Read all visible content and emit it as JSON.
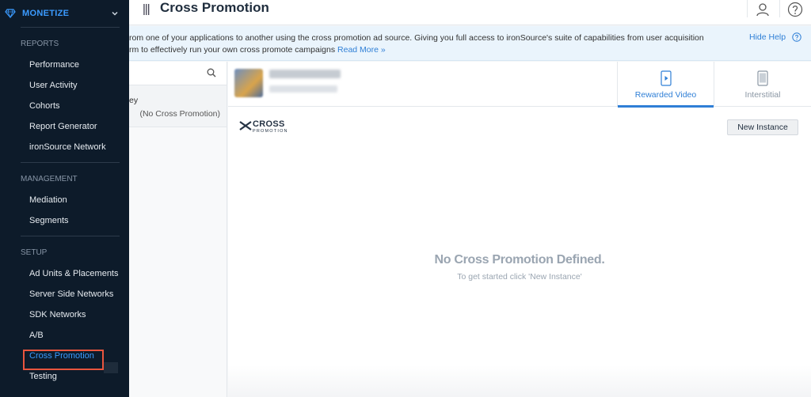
{
  "sidebar": {
    "brand": "MONETIZE",
    "sections": {
      "reports": "REPORTS",
      "management": "MANAGEMENT",
      "setup": "SETUP"
    },
    "items": {
      "performance": "Performance",
      "user_activity": "User Activity",
      "cohorts": "Cohorts",
      "report_generator": "Report Generator",
      "ironsource_network": "ironSource Network",
      "mediation": "Mediation",
      "segments": "Segments",
      "ad_units": "Ad Units & Placements",
      "server_side": "Server Side Networks",
      "sdk_networks": "SDK Networks",
      "ab": "A/B",
      "cross_promotion": "Cross Promotion",
      "testing": "Testing"
    }
  },
  "header": {
    "title": "Cross Promotion"
  },
  "banner": {
    "line1": "rom one of your applications to another using the cross promotion ad source. Giving you full access to ironSource's suite of capabilities from user acquisition",
    "line2": "rm to effectively run your own cross promote campaigns",
    "read_more": "Read More »",
    "hide_help": "Hide Help"
  },
  "app_list": {
    "item_name": "ey",
    "item_state": "(No Cross Promotion)"
  },
  "tabs": {
    "rewarded_video": "Rewarded Video",
    "interstitial": "Interstitial"
  },
  "logo": {
    "big": "CROSS",
    "small": "PROMOTION"
  },
  "new_instance": "New Instance",
  "empty_state": {
    "title": "No Cross Promotion Defined.",
    "subtitle": "To get started click 'New Instance'"
  },
  "colors": {
    "accent": "#2f7fd6",
    "sidebar_bg": "#0d1b2a",
    "highlight": "#e8553e"
  }
}
